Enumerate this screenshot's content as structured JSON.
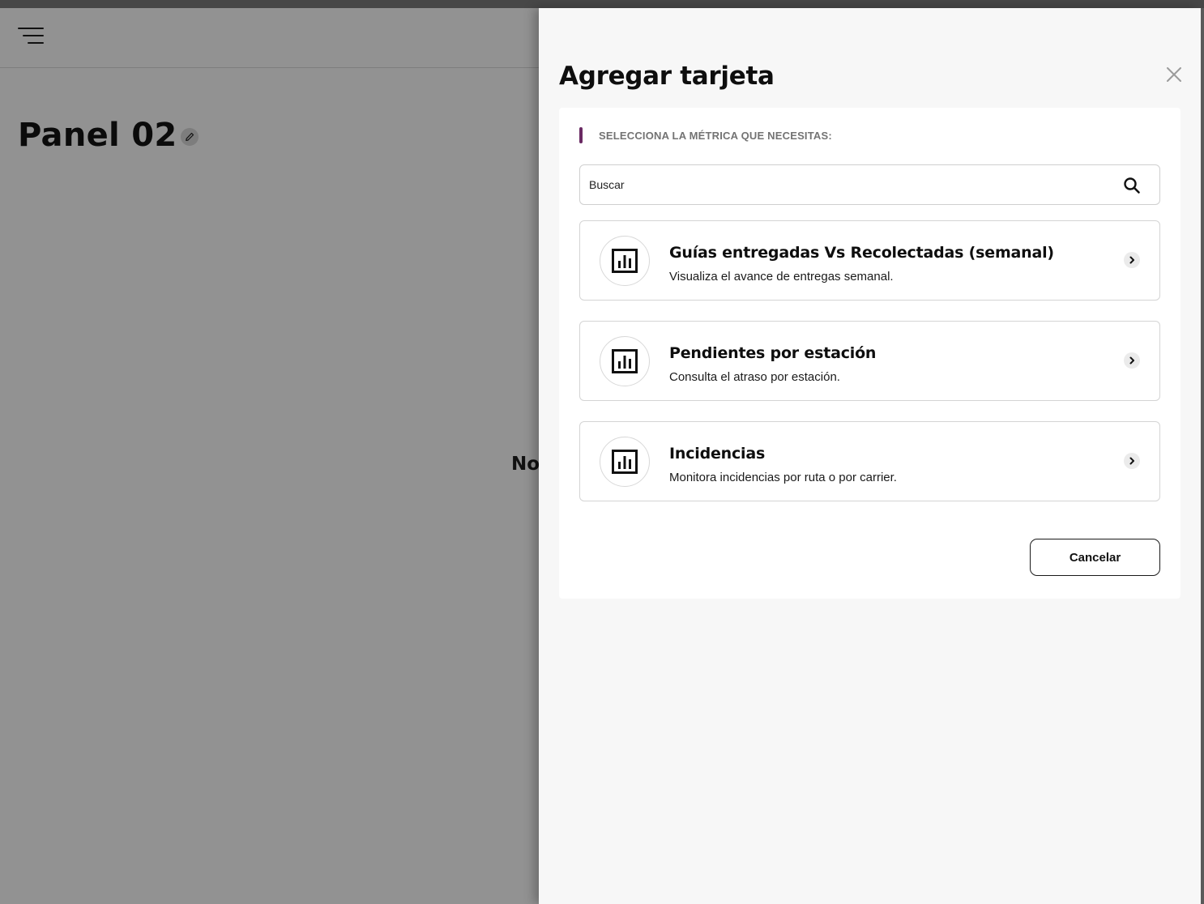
{
  "background": {
    "page_title": "Panel 02",
    "empty_state_partial": "No"
  },
  "drawer": {
    "title": "Agregar tarjeta",
    "section_label": "SELECCIONA LA MÉTRICA QUE NECESITAS:",
    "search": {
      "placeholder": "Buscar",
      "value": ""
    },
    "metrics": [
      {
        "title": "Guías entregadas Vs Recolectadas (semanal)",
        "description": "Visualiza el avance de entregas semanal.",
        "icon": "bar-chart-icon"
      },
      {
        "title": "Pendientes por estación",
        "description": "Consulta el atraso por estación.",
        "icon": "bar-chart-icon"
      },
      {
        "title": "Incidencias",
        "description": "Monitora incidencias por ruta o por carrier.",
        "icon": "bar-chart-icon"
      }
    ],
    "cancel_label": "Cancelar"
  },
  "colors": {
    "accent": "#6a2a63",
    "overlay": "#929292",
    "drawer_bg": "#f7f7f7"
  }
}
